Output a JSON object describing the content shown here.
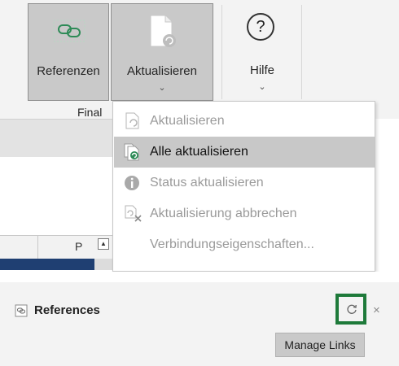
{
  "ribbon": {
    "buttons": {
      "references": {
        "label": "Referenzen"
      },
      "update": {
        "label": "Aktualisieren",
        "chevron": "⌄"
      },
      "help": {
        "label": "Hilfe",
        "glyph": "?",
        "chevron": "⌄"
      }
    },
    "group_label": "Final"
  },
  "sheet": {
    "column_letter": "P"
  },
  "menu": {
    "items": [
      {
        "label": "Aktualisieren",
        "icon": "refresh-doc-icon",
        "highlighted": false
      },
      {
        "label": "Alle aktualisieren",
        "icon": "refresh-all-icon",
        "highlighted": true
      },
      {
        "label": "Status aktualisieren",
        "icon": "info-icon",
        "highlighted": false
      },
      {
        "label": "Aktualisierung abbrechen",
        "icon": "cancel-update-icon",
        "highlighted": false
      },
      {
        "label": "Verbindungseigenschaften...",
        "icon": "",
        "highlighted": false
      }
    ]
  },
  "panel": {
    "title": "References",
    "close_glyph": "×",
    "tooltip": "Manage Links",
    "highlight_color": "#1e7a3a"
  },
  "colors": {
    "ribbon_bg": "#f3f3f3",
    "pressed_bg": "#c9c9c9",
    "menu_highlight": "#c8c8c8",
    "sheet_selection": "#1f3f72",
    "link_icon": "#2e8b57"
  }
}
